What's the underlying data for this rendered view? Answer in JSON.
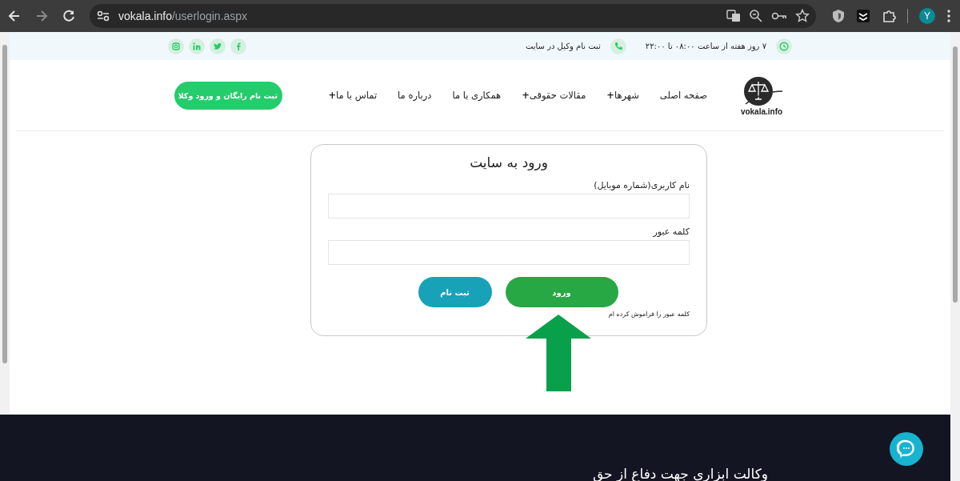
{
  "browser": {
    "url_host": "vokala.info",
    "url_path": "/userlogin.aspx",
    "profile_initial": "Y"
  },
  "topbar": {
    "hours": "۷ روز هفته از ساعت ۰۸:۰۰ تا ۲۲:۰۰",
    "register": "ثبت نام وکیل در سایت"
  },
  "header": {
    "logo_text": "vokala.info",
    "nav": [
      {
        "label": "صفحه اصلی"
      },
      {
        "label": "شهرها**+**"
      },
      {
        "label": "مقالات حقوقی**+**"
      },
      {
        "label": "همکاری با ما"
      },
      {
        "label": "درباره ما"
      },
      {
        "label": "تماس با ما**+**"
      }
    ],
    "cta": "ثبت نام رایگان و ورود وکلا"
  },
  "login": {
    "title": "ورود به سایت",
    "fields": [
      {
        "label": "نام کاربری(شماره موبایل)"
      },
      {
        "label": "کلمه عبور"
      }
    ],
    "buttons": [
      {
        "label": "ورود",
        "kind": "primary"
      },
      {
        "label": "ثبت نام",
        "kind": "secondary"
      }
    ],
    "forgot": "کلمه عبور را فراموش کرده ام"
  },
  "footer": {
    "heading": "وکالت ابزاری جهت دفاع از حق"
  }
}
